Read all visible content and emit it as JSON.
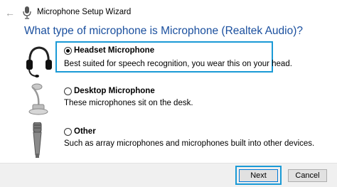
{
  "window": {
    "title": "Microphone Setup Wizard"
  },
  "heading": "What type of microphone is Microphone (Realtek Audio)?",
  "options": [
    {
      "label": "Headset Microphone",
      "description": "Best suited for speech recognition, you wear this on your head.",
      "selected": true,
      "icon": "headset-icon"
    },
    {
      "label": "Desktop Microphone",
      "description": "These microphones sit on the desk.",
      "selected": false,
      "icon": "desktop-microphone-icon"
    },
    {
      "label": "Other",
      "description": "Such as array microphones and microphones built into other devices.",
      "selected": false,
      "icon": "handheld-microphone-icon"
    }
  ],
  "buttons": {
    "next": "Next",
    "cancel": "Cancel"
  },
  "colors": {
    "heading": "#1a4f9e",
    "highlight": "#1a9ad6"
  }
}
